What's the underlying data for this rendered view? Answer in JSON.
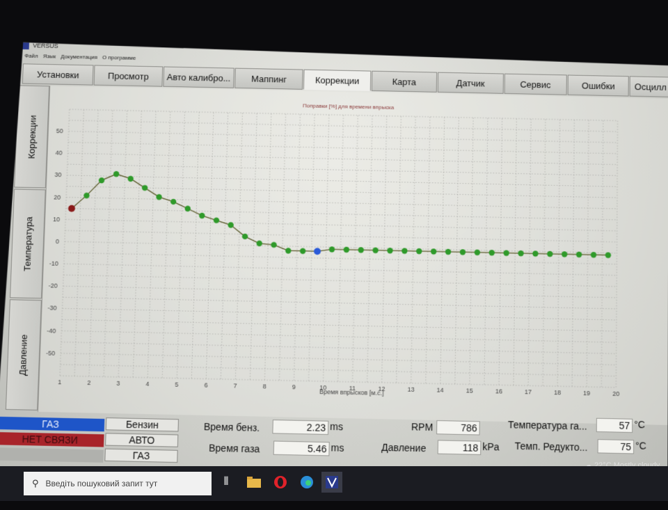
{
  "window": {
    "title": "VERSUS"
  },
  "menu": [
    "Файл",
    "Язык",
    "Документация",
    "О программе"
  ],
  "tabs": [
    {
      "label": "Установки",
      "active": false
    },
    {
      "label": "Просмотр",
      "active": false
    },
    {
      "label": "Авто калибро...",
      "active": false
    },
    {
      "label": "Маппинг",
      "active": false
    },
    {
      "label": "Коррекции",
      "active": true
    },
    {
      "label": "Карта",
      "active": false
    },
    {
      "label": "Датчик",
      "active": false
    },
    {
      "label": "Сервис",
      "active": false
    },
    {
      "label": "Ошибки",
      "active": false
    },
    {
      "label": "Осцилл",
      "active": false
    }
  ],
  "side_tabs": [
    "Коррекции",
    "Температура",
    "Давление"
  ],
  "chart_data": {
    "type": "line",
    "title": "Поправки [%] для времени впрыска",
    "xlabel": "Время впрысков [м.с.]",
    "ylabel": "[%]",
    "xlim": [
      1,
      20
    ],
    "ylim": [
      -60,
      60
    ],
    "x_ticks": [
      1,
      2,
      3,
      4,
      5,
      6,
      7,
      8,
      9,
      10,
      11,
      12,
      13,
      14,
      15,
      16,
      17,
      18,
      19,
      20
    ],
    "y_ticks": [
      50,
      40,
      30,
      20,
      10,
      0,
      -10,
      -20,
      -30,
      -40,
      -50
    ],
    "grid": true,
    "colors": {
      "line": "#5a5a2a",
      "point": "#2f9a2a",
      "start_point": "#8a1a1a",
      "selected_point": "#2a5ad8"
    },
    "series": [
      {
        "x": [
          1.2,
          1.7,
          2.2,
          2.7,
          3.2,
          3.7,
          4.2,
          4.7,
          5.2,
          5.7,
          6.2,
          6.7,
          7.2,
          7.7,
          8.2,
          8.7,
          9.2,
          9.7,
          10.2,
          10.7,
          11.2,
          11.7,
          12.2,
          12.7,
          13.2,
          13.7,
          14.2,
          14.7,
          15.2,
          15.7,
          16.2,
          16.7,
          17.2,
          17.7,
          18.2,
          18.7,
          19.2,
          19.7
        ],
        "values": [
          15,
          21,
          28,
          31,
          29,
          25,
          21,
          19,
          16,
          13,
          11,
          9,
          4,
          1,
          0.5,
          -2,
          -2,
          -2,
          -1,
          -1,
          -1,
          -1,
          -1,
          -1,
          -1,
          -1,
          -1,
          -1,
          -1,
          -1,
          -1,
          -1,
          -1,
          -1,
          -1,
          -1,
          -1,
          -1
        ]
      }
    ],
    "start_index": 0,
    "selected_index": 17
  },
  "status": {
    "gas": "ГАЗ",
    "link": "НЕТ СВЯЗИ"
  },
  "mode_buttons": [
    "Бензин",
    "АВТО",
    "ГАЗ"
  ],
  "readouts": {
    "petrol_time": {
      "label": "Время бенз.",
      "value": "2.23",
      "unit": "ms"
    },
    "gas_time": {
      "label": "Время газа",
      "value": "5.46",
      "unit": "ms"
    },
    "rpm": {
      "label": "RPM",
      "value": "786"
    },
    "pressure": {
      "label": "Давление",
      "value": "118",
      "unit": "kPa"
    },
    "gas_temp": {
      "label": "Температура га...",
      "value": "57",
      "unit": "°C"
    },
    "reducer_temp": {
      "label": "Темп. Редукто...",
      "value": "75",
      "unit": "°C"
    }
  },
  "taskbar": {
    "search_placeholder": "Введіть пошуковий запит тут",
    "weather": "22°C  Mostly cloudy",
    "icons": [
      "start-icon",
      "search-icon",
      "task-view-icon",
      "file-explorer-icon",
      "opera-icon",
      "edge-icon",
      "versus-app-icon",
      "weather-icon"
    ]
  }
}
